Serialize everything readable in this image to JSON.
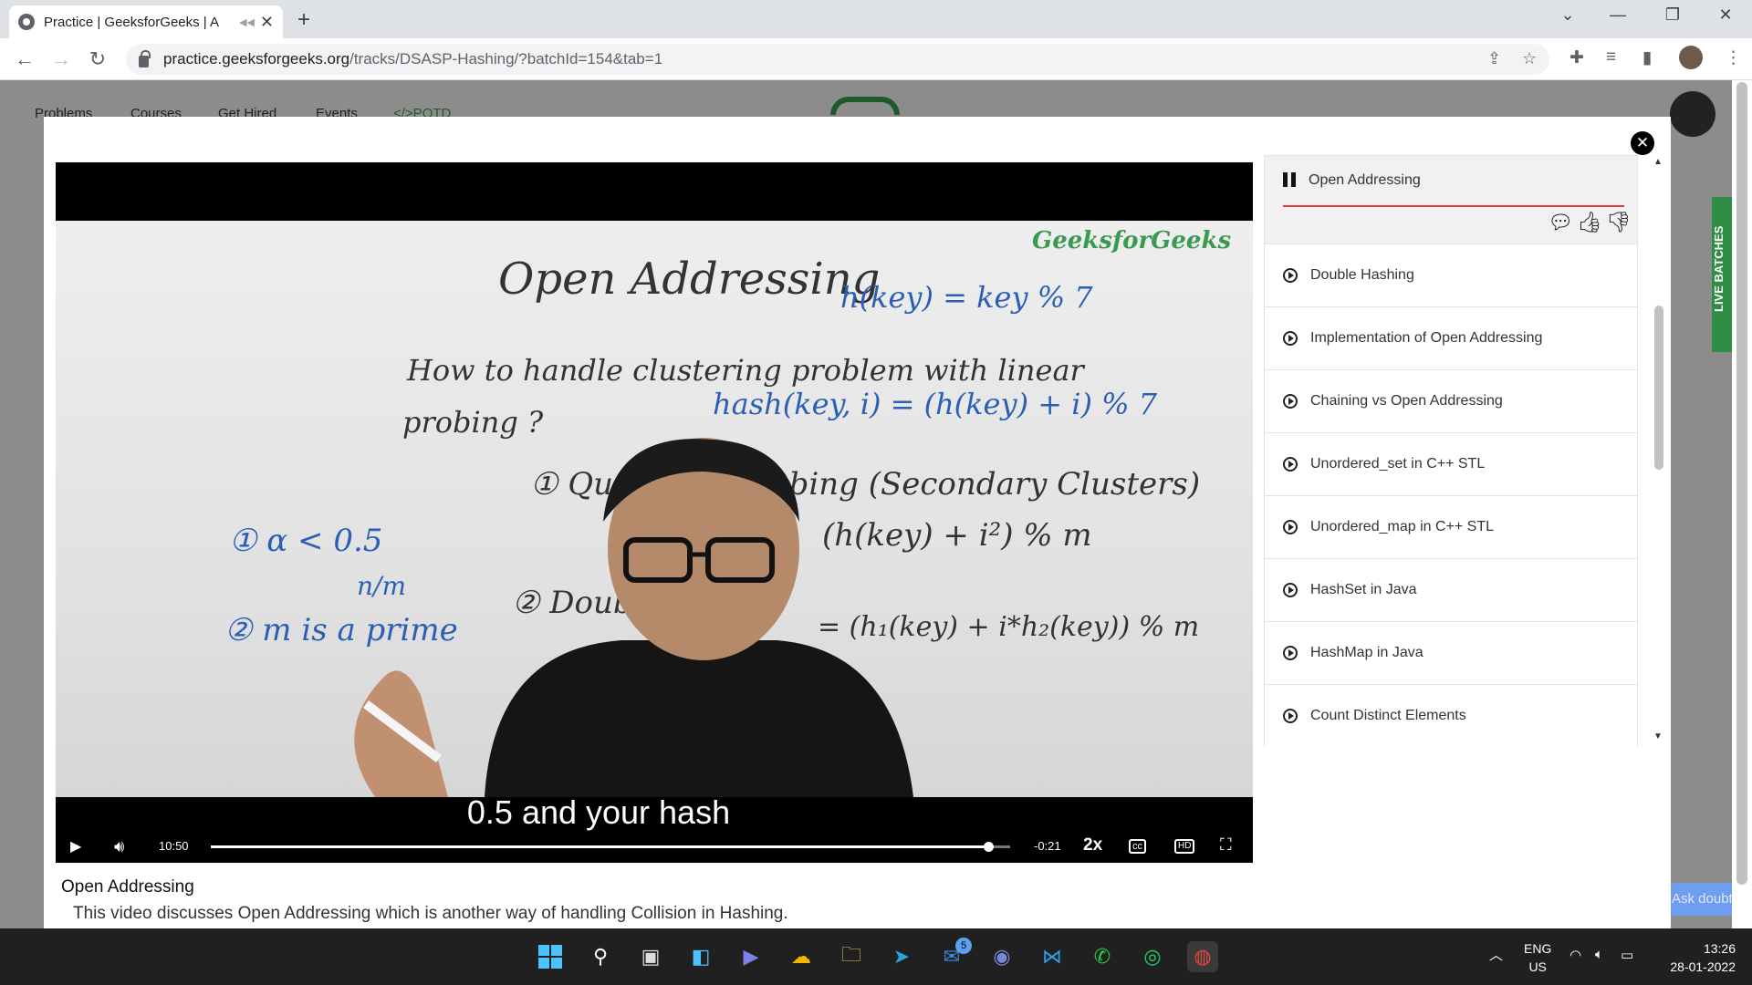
{
  "browser": {
    "tab_title": "Practice | GeeksforGeeks | A",
    "tab_mute_icon": "◀◀",
    "url_host": "practice.geeksforgeeks.org",
    "url_path": "/tracks/DSASP-Hashing/?batchId=154&tab=1"
  },
  "site_nav": {
    "items": [
      "Problems",
      "Courses",
      "Get Hired",
      "Events",
      "</>POTD"
    ]
  },
  "side_badge": "LIVE BATCHES",
  "ask_doubt": "Ask doubt",
  "video": {
    "subtitle": "0.5 and your hash",
    "current_time": "10:50",
    "remaining_time": "-0:21",
    "speed": "2x",
    "progress": 0.973,
    "board_lines": {
      "title": "Open Addressing",
      "watermark": "GeeksforGeeks",
      "formula1": "h(key) = key % 7",
      "question": "How to handle clustering problem with linear",
      "question2": "probing ?",
      "formula2": "hash(key, i) = (h(key) + i) % 7",
      "quad": "① Quadratic Probing (Secondary Clusters)",
      "quad_formula": "(h(key) + i²) % m",
      "alpha": "① α < 0.5",
      "nm": "n/m",
      "prime": "② m is a prime",
      "double": "② Double",
      "double_formula": "= (h₁(key) + i*h₂(key)) % m"
    }
  },
  "description": {
    "title": "Open Addressing",
    "text": "This video discusses Open Addressing which is another way of handling Collision in Hashing."
  },
  "playlist": {
    "active": "Open Addressing",
    "items": [
      "Double Hashing",
      "Implementation of Open Addressing",
      "Chaining vs Open Addressing",
      "Unordered_set in C++ STL",
      "Unordered_map in C++ STL",
      "HashSet in Java",
      "HashMap in Java",
      "Count Distinct Elements"
    ]
  },
  "taskbar": {
    "mail_badge": "5",
    "lang1": "ENG",
    "lang2": "US",
    "time": "13:26",
    "date": "28-01-2022"
  }
}
